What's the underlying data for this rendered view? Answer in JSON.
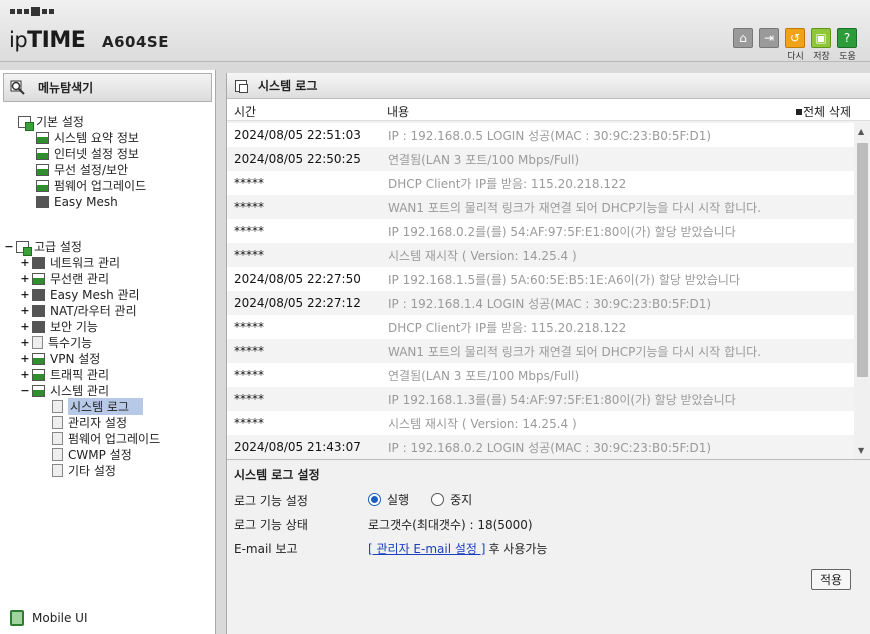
{
  "header": {
    "brand_ip": "ip",
    "brand_time": "TIME",
    "model": "A604SE",
    "icons": [
      {
        "name": "home-icon",
        "label": ""
      },
      {
        "name": "logout-icon",
        "label": ""
      },
      {
        "name": "refresh-icon",
        "label": "다시"
      },
      {
        "name": "save-icon",
        "label": "저장"
      },
      {
        "name": "help-icon",
        "label": "도움"
      }
    ]
  },
  "sidebar": {
    "title": "메뉴탐색기",
    "basic": {
      "label": "기본 설정",
      "items": [
        "시스템 요약 정보",
        "인터넷 설정 정보",
        "무선 설정/보안",
        "펌웨어 업그레이드",
        "Easy Mesh"
      ]
    },
    "advanced": {
      "toggle": "−",
      "label": "고급 설정",
      "items": [
        {
          "toggle": "+",
          "label": "네트워크 관리"
        },
        {
          "toggle": "+",
          "label": "무선랜 관리"
        },
        {
          "toggle": "+",
          "label": "Easy Mesh 관리"
        },
        {
          "toggle": "+",
          "label": "NAT/라우터 관리"
        },
        {
          "toggle": "+",
          "label": "보안 기능"
        },
        {
          "toggle": "+",
          "label": "특수기능"
        },
        {
          "toggle": "+",
          "label": "VPN 설정"
        },
        {
          "toggle": "+",
          "label": "트래픽 관리"
        },
        {
          "toggle": "−",
          "label": "시스템 관리"
        }
      ],
      "system_items": [
        "시스템 로그",
        "관리자 설정",
        "펌웨어 업그레이드",
        "CWMP 설정",
        "기타 설정"
      ]
    },
    "mobile": "Mobile UI"
  },
  "main": {
    "title": "시스템 로그",
    "col_time": "시간",
    "col_content": "내용",
    "delete_all": "전체 삭제",
    "logs": [
      {
        "time": "2024/08/05 22:51:03",
        "msg": "IP : 192.168.0.5 LOGIN 성공(MAC : 30:9C:23:B0:5F:D1)"
      },
      {
        "time": "2024/08/05 22:50:25",
        "msg": "연결됨(LAN 3 포트/100 Mbps/Full)"
      },
      {
        "time": "*****",
        "msg": "DHCP Client가 IP를 받음: 115.20.218.122"
      },
      {
        "time": "*****",
        "msg": "WAN1 포트의 물리적 링크가 재연결 되어 DHCP기능을 다시 시작 합니다."
      },
      {
        "time": "*****",
        "msg": "IP 192.168.0.2를(를) 54:AF:97:5F:E1:80이(가) 할당 받았습니다"
      },
      {
        "time": "*****",
        "msg": "시스템 재시작 ( Version: 14.25.4 )"
      },
      {
        "time": "2024/08/05 22:27:50",
        "msg": "IP 192.168.1.5를(를) 5A:60:5E:B5:1E:A6이(가) 할당 받았습니다"
      },
      {
        "time": "2024/08/05 22:27:12",
        "msg": "IP : 192.168.1.4 LOGIN 성공(MAC : 30:9C:23:B0:5F:D1)"
      },
      {
        "time": "*****",
        "msg": "DHCP Client가 IP를 받음: 115.20.218.122"
      },
      {
        "time": "*****",
        "msg": "WAN1 포트의 물리적 링크가 재연결 되어 DHCP기능을 다시 시작 합니다."
      },
      {
        "time": "*****",
        "msg": "연결됨(LAN 3 포트/100 Mbps/Full)"
      },
      {
        "time": "*****",
        "msg": "IP 192.168.1.3를(를) 54:AF:97:5F:E1:80이(가) 할당 받았습니다"
      },
      {
        "time": "*****",
        "msg": "시스템 재시작 ( Version: 14.25.4 )"
      },
      {
        "time": "2024/08/05 21:43:07",
        "msg": "IP : 192.168.0.2 LOGIN 성공(MAC : 30:9C:23:B0:5F:D1)"
      }
    ],
    "settings": {
      "title": "시스템 로그 설정",
      "log_func_label": "로그 기능 설정",
      "opt_run": "실행",
      "opt_stop": "중지",
      "log_status_label": "로그 기능 상태",
      "log_status_value": "로그갯수(최대갯수) : 18(5000)",
      "email_label": "E-mail 보고",
      "email_link": "[ 관리자 E-mail 설정 ]",
      "email_suffix": "후 사용가능",
      "apply": "적용"
    }
  }
}
